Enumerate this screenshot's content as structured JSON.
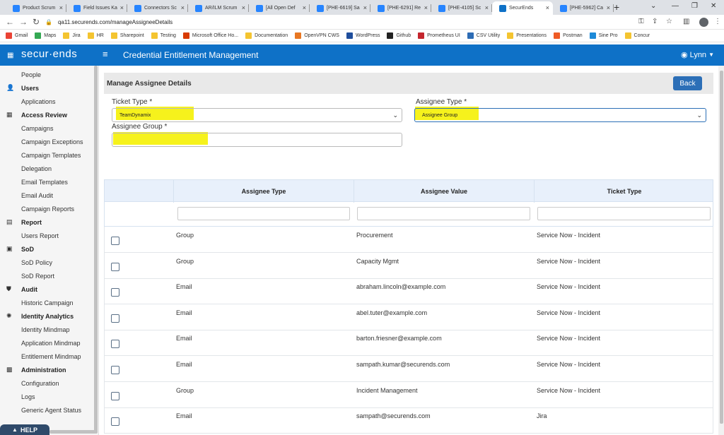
{
  "browser": {
    "tabs": [
      {
        "label": "Product Scrum",
        "active": false
      },
      {
        "label": "Field Issues Ka",
        "active": false
      },
      {
        "label": "Connectors Sc",
        "active": false
      },
      {
        "label": "AR/ILM Scrum",
        "active": false
      },
      {
        "label": "[All Open Def",
        "active": false
      },
      {
        "label": "[PHE-6619] Sa",
        "active": false
      },
      {
        "label": "[PHE-6291] Re",
        "active": false
      },
      {
        "label": "[PHE-4105] Sc",
        "active": false
      },
      {
        "label": "SecurEnds",
        "active": true
      },
      {
        "label": "[PHE-5962] Ca",
        "active": false
      }
    ],
    "url": "qa11.securends.com/manageAssigneeDetails",
    "bookmarks": [
      {
        "label": "Gmail",
        "color": "#ea4335"
      },
      {
        "label": "Maps",
        "color": "#34a853"
      },
      {
        "label": "Jira",
        "color": "#f4c430"
      },
      {
        "label": "HR",
        "color": "#f4c430"
      },
      {
        "label": "Sharepoint",
        "color": "#f4c430"
      },
      {
        "label": "Testing",
        "color": "#f4c430"
      },
      {
        "label": "Microsoft Office Ho...",
        "color": "#d83b01"
      },
      {
        "label": "Documentation",
        "color": "#f4c430"
      },
      {
        "label": "OpenVPN CWS",
        "color": "#e87722"
      },
      {
        "label": "WordPress",
        "color": "#1f4e9c"
      },
      {
        "label": "Github",
        "color": "#222222"
      },
      {
        "label": "Prometheus UI",
        "color": "#c4262e"
      },
      {
        "label": "CSV Utility",
        "color": "#2d6cb5"
      },
      {
        "label": "Presentations",
        "color": "#f4c430"
      },
      {
        "label": "Postman",
        "color": "#ef5b25"
      },
      {
        "label": "Sine Pro",
        "color": "#1d8ad8"
      },
      {
        "label": "Concur",
        "color": "#f4c430"
      }
    ]
  },
  "topbar": {
    "logo": "secur·ends",
    "title": "Credential Entitlement Management",
    "user": "Lynn"
  },
  "sidebar": {
    "items": [
      {
        "label": "People",
        "type": "item"
      },
      {
        "label": "Users",
        "type": "head",
        "icon": "user-icon"
      },
      {
        "label": "Applications",
        "type": "item"
      },
      {
        "label": "Access Review",
        "type": "head",
        "icon": "grid-icon"
      },
      {
        "label": "Campaigns",
        "type": "item"
      },
      {
        "label": "Campaign Exceptions",
        "type": "item"
      },
      {
        "label": "Campaign Templates",
        "type": "item"
      },
      {
        "label": "Delegation",
        "type": "item"
      },
      {
        "label": "Email Templates",
        "type": "item"
      },
      {
        "label": "Email Audit",
        "type": "item"
      },
      {
        "label": "Campaign Reports",
        "type": "item"
      },
      {
        "label": "Report",
        "type": "head",
        "icon": "file-icon"
      },
      {
        "label": "Users Report",
        "type": "item"
      },
      {
        "label": "SoD",
        "type": "head",
        "icon": "table-icon"
      },
      {
        "label": "SoD Policy",
        "type": "item"
      },
      {
        "label": "SoD Report",
        "type": "item"
      },
      {
        "label": "Audit",
        "type": "head",
        "icon": "shield-icon"
      },
      {
        "label": "Historic Campaign",
        "type": "item"
      },
      {
        "label": "Identity Analytics",
        "type": "head",
        "icon": "brain-icon"
      },
      {
        "label": "Identity Mindmap",
        "type": "item"
      },
      {
        "label": "Application Mindmap",
        "type": "item"
      },
      {
        "label": "Entitlement Mindmap",
        "type": "item"
      },
      {
        "label": "Administration",
        "type": "head",
        "icon": "admin-icon"
      },
      {
        "label": "Configuration",
        "type": "item"
      },
      {
        "label": "Logs",
        "type": "item"
      },
      {
        "label": "Generic Agent Status",
        "type": "item"
      }
    ],
    "help": "HELP"
  },
  "page": {
    "title": "Manage Assignee Details",
    "back_label": "Back"
  },
  "form": {
    "ticket_type_label": "Ticket Type *",
    "ticket_type_value": "TeamDynamix",
    "assignee_type_label": "Assignee Type *",
    "assignee_type_value": "Assignee Group",
    "assignee_group_label": "Assignee Group *",
    "assignee_group_value": ""
  },
  "table": {
    "headers": [
      "Assignee Type",
      "Assignee Value",
      "Ticket Type"
    ],
    "rows": [
      {
        "type": "Group",
        "value": "Procurement",
        "ticket": "Service Now - Incident"
      },
      {
        "type": "Group",
        "value": "Capacity Mgmt",
        "ticket": "Service Now - Incident"
      },
      {
        "type": "Email",
        "value": "abraham.lincoln@example.com",
        "ticket": "Service Now - Incident"
      },
      {
        "type": "Email",
        "value": "abel.tuter@example.com",
        "ticket": "Service Now - Incident"
      },
      {
        "type": "Email",
        "value": "barton.friesner@example.com",
        "ticket": "Service Now - Incident"
      },
      {
        "type": "Email",
        "value": "sampath.kumar@securends.com",
        "ticket": "Service Now - Incident"
      },
      {
        "type": "Group",
        "value": "Incident Management",
        "ticket": "Service Now - Incident"
      },
      {
        "type": "Email",
        "value": "sampath@securends.com",
        "ticket": "Jira"
      }
    ]
  },
  "colors": {
    "brand": "#0e71c7",
    "highlight": "#f6f21c",
    "button": "#2c6fb7"
  }
}
